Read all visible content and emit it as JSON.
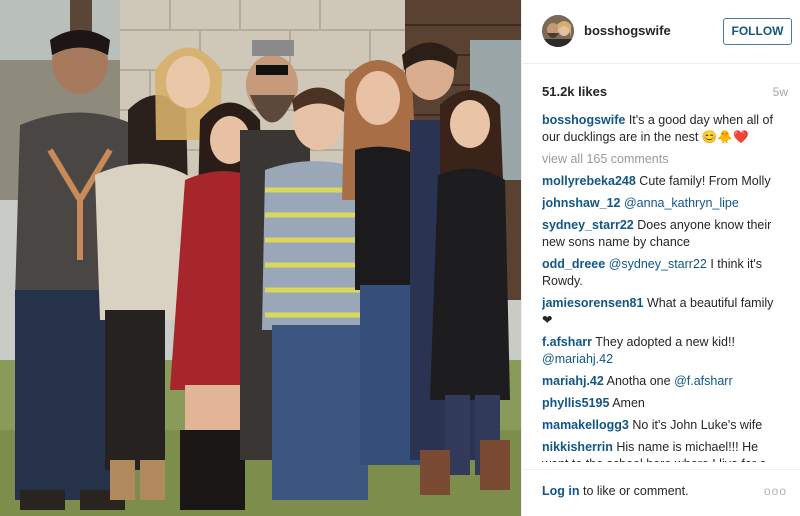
{
  "photo": {
    "description_icon": "family-photo"
  },
  "header": {
    "username": "bosshogswife",
    "follow_label": "FOLLOW"
  },
  "stats": {
    "likes": "51.2k likes",
    "age": "5w"
  },
  "caption": {
    "user": "bosshogswife",
    "text": "It's a good day when all of our ducklings are in the nest",
    "emoji": "😊🐥❤️"
  },
  "view_all": "view all 165 comments",
  "comments": [
    {
      "user": "mollyrebeka248",
      "text": "Cute family! From Molly"
    },
    {
      "user": "johnshaw_12",
      "mention": "@anna_kathryn_lipe",
      "text": ""
    },
    {
      "user": "sydney_starr22",
      "text": "Does anyone know their new sons name by chance"
    },
    {
      "user": "odd_dreee",
      "mention": "@sydney_starr22",
      "text": "I think it's Rowdy."
    },
    {
      "user": "jamiesorensen81",
      "text": "What a beautiful family ❤"
    },
    {
      "user": "f.afsharr",
      "text": "They adopted a new kid!!",
      "mention_after": "@mariahj.42"
    },
    {
      "user": "mariahj.42",
      "text": "Anotha one",
      "mention_after": "@f.afsharr"
    },
    {
      "user": "phyllis5195",
      "text": "Amen"
    },
    {
      "user": "mamakellogg3",
      "text": "No it's John Luke's wife"
    },
    {
      "user": "nikkisherrin",
      "text": "His name is michael!!! He went to the school here where I live for a"
    }
  ],
  "footer": {
    "login_link": "Log in",
    "login_text": " to like or comment.",
    "more_icon": "more-dots-icon",
    "more_label": "ooo"
  }
}
